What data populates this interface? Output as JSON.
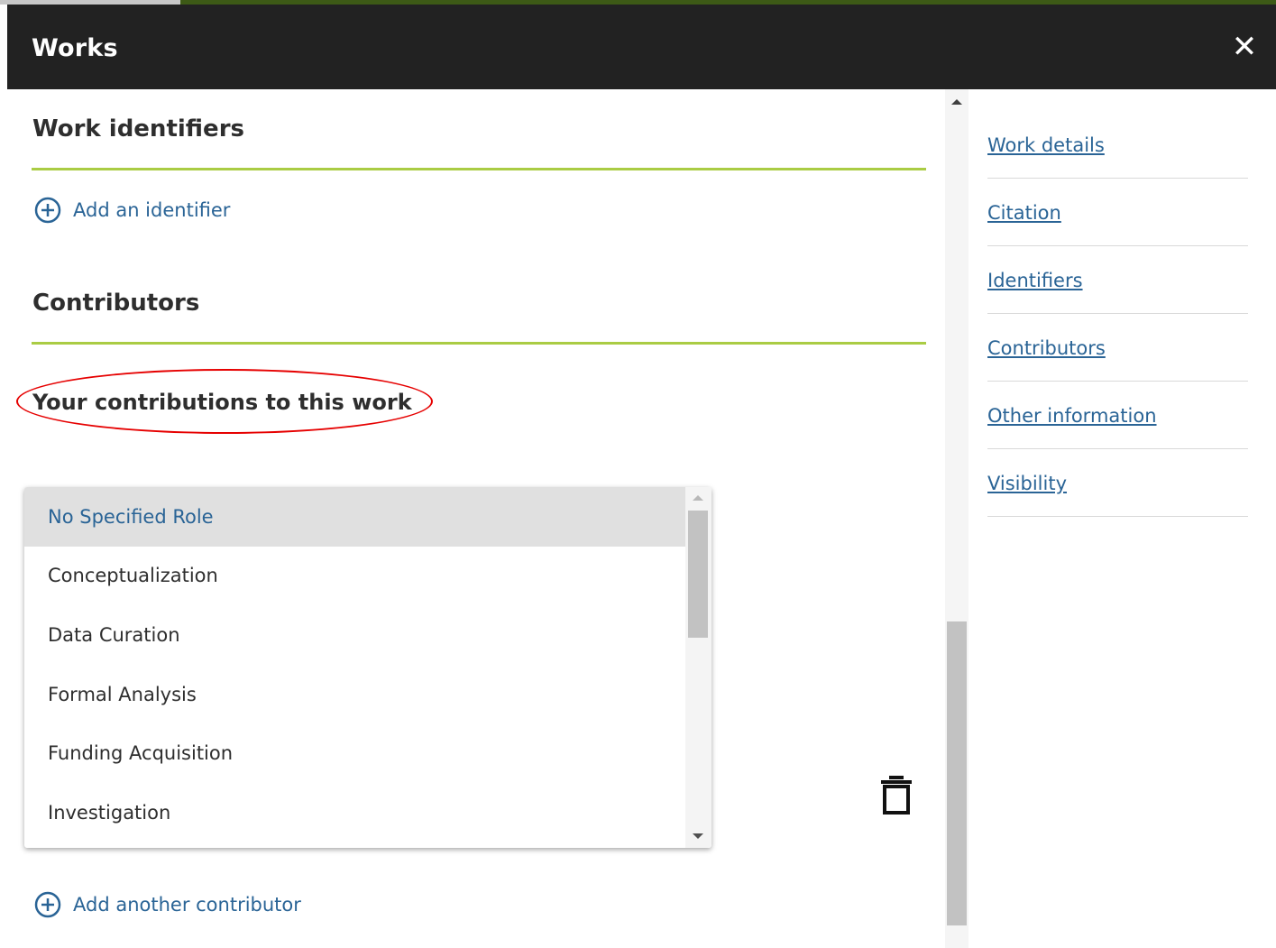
{
  "modal": {
    "title": "Works",
    "close_icon": "close-icon"
  },
  "identifiers": {
    "heading": "Work identifiers",
    "add_label": "Add an identifier"
  },
  "contributors": {
    "heading": "Contributors",
    "your_contributions_label": "Your contributions to this work",
    "add_label": "Add another contributor"
  },
  "role_dropdown": {
    "selected": "No Specified Role",
    "options": [
      "No Specified Role",
      "Conceptualization",
      "Data Curation",
      "Formal Analysis",
      "Funding Acquisition",
      "Investigation"
    ]
  },
  "side_nav": {
    "items": [
      "Work details",
      "Citation",
      "Identifiers",
      "Contributors",
      "Other information",
      "Visibility"
    ]
  },
  "colors": {
    "header_bg": "#222222",
    "accent_rule": "#aacc44",
    "link": "#2a6496",
    "highlight": "#e60000"
  }
}
